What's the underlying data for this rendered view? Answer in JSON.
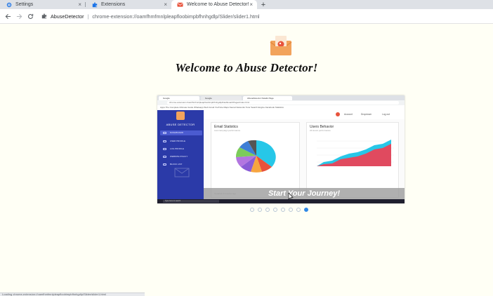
{
  "browser": {
    "tabs": [
      {
        "label": "Settings",
        "icon": "gear-icon",
        "active": false
      },
      {
        "label": "Extensions",
        "icon": "puzzle-icon",
        "active": false
      },
      {
        "label": "Welcome to Abuse Detector!",
        "icon": "envelope-icon",
        "active": true
      }
    ],
    "new_tab": "+",
    "close_glyph": "×",
    "address": {
      "site_name": "AbuseDetector",
      "separator": "|",
      "url": "chrome-extension://oamfhmfmnlpleapfloobimpbfhnhgdlp/Slider/slider1.html"
    }
  },
  "page": {
    "title": "Welcome to Abuse Detector!",
    "slide": {
      "banner_text": "Start Your Journey!",
      "screenshot": {
        "tabs": [
          "Google",
          "Google",
          "AbuseDetector Details Page"
        ],
        "address": "chrome-extension://oamfhmfmnlpleapfloobimpbfhnhgdlp/Dashboard/Pages/index.html",
        "bookmarks": "Apps   The Complete Ultimate Guide   Whatsapp Web   Gmail   YouTube   Maps   Neural Networks   Tutor Search Engine   Facebook   Statistics",
        "sidebar_brand": "ABUSE DETECTOR",
        "sidebar_items": [
          "DASHBOARD",
          "USER PROFILE",
          "LOG PROFILE",
          "WEBSITE POLICY",
          "BLOCK LIST"
        ],
        "topnav": [
          "Account",
          "Dropdown",
          "Log out"
        ],
        "email_card": {
          "title": "Email Statistics",
          "subtitle": "Last campaign performance",
          "footer": "Updated 3 minutes ago"
        },
        "users_card": {
          "title": "Users Behavior",
          "subtitle": "24 Hours performance",
          "footer": "Updated 3 minutes ago"
        },
        "taskbar_search": "Type here to search"
      }
    },
    "pagination": {
      "count": 8,
      "active_index": 7
    },
    "status_text": "Loading chrome-extension://oamfhmfmnlpleapfloobimpbfhnhgdlp/Slider/slider1.html"
  },
  "colors": {
    "page_bg": "#fffff5",
    "accent": "#2f88e6",
    "sidebar": "#2b3aa8"
  }
}
